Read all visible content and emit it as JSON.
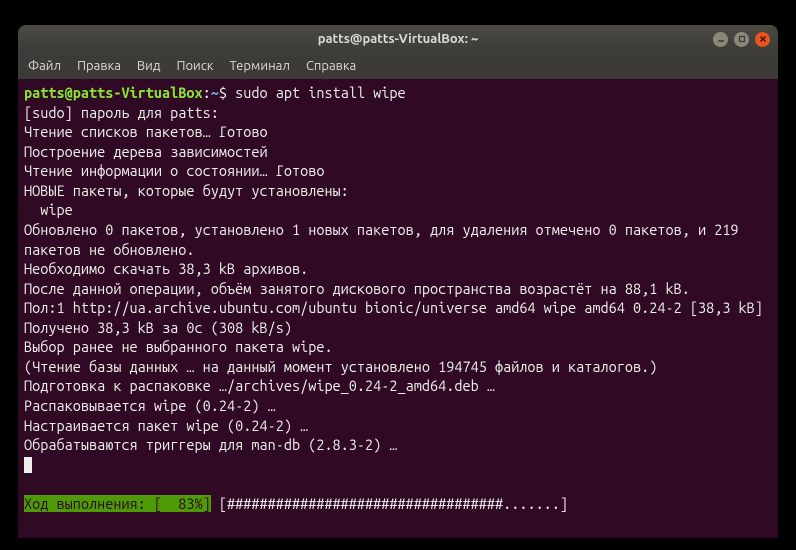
{
  "titlebar": {
    "title": "patts@patts-VirtualBox: ~"
  },
  "menubar": {
    "file": "Файл",
    "edit": "Правка",
    "view": "Вид",
    "search": "Поиск",
    "terminal": "Терминал",
    "help": "Справка"
  },
  "prompt": {
    "user_host": "patts@patts-VirtualBox",
    "colon": ":",
    "path": "~",
    "symbol": "$ ",
    "command": "sudo apt install wipe"
  },
  "output": {
    "l1": "[sudo] пароль для patts:",
    "l2": "Чтение списков пакетов… Готово",
    "l3": "Построение дерева зависимостей",
    "l4": "Чтение информации о состоянии… Готово",
    "l5": "НОВЫЕ пакеты, которые будут установлены:",
    "l6": "  wipe",
    "l7": "Обновлено 0 пакетов, установлено 1 новых пакетов, для удаления отмечено 0 пакетов, и 219 пакетов не обновлено.",
    "l8": "Необходимо скачать 38,3 kB архивов.",
    "l9": "После данной операции, объём занятого дискового пространства возрастёт на 88,1 kB.",
    "l10": "Пол:1 http://ua.archive.ubuntu.com/ubuntu bionic/universe amd64 wipe amd64 0.24-2 [38,3 kB]",
    "l11": "Получено 38,3 kB за 0с (308 kB/s)",
    "l12": "Выбор ранее не выбранного пакета wipe.",
    "l13": "(Чтение базы данных … на данный момент установлено 194745 файлов и каталогов.)",
    "l14": "Подготовка к распаковке …/archives/wipe_0.24-2_amd64.deb …",
    "l15": "Распаковывается wipe (0.24-2) …",
    "l16": "Настраивается пакет wipe (0.24-2) …",
    "l17": "Обрабатываются триггеры для man-db (2.8.3-2) …"
  },
  "progress": {
    "label": "Ход выполнения: [  83%]",
    "bar": " [##################################.......]"
  }
}
